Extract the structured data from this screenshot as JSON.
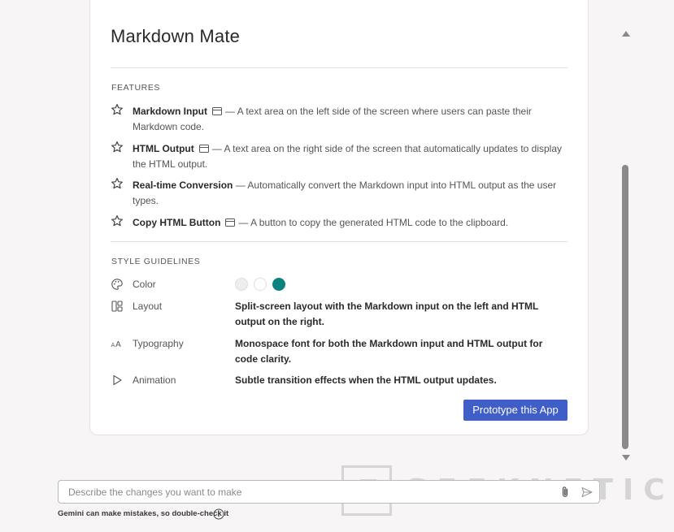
{
  "app": {
    "title": "Markdown Mate"
  },
  "features": {
    "heading": "FEATURES",
    "items": [
      {
        "name": "Markdown Input",
        "has_window_icon": true,
        "description": "— A text area on the left side of the screen where users can paste their Markdown code."
      },
      {
        "name": "HTML Output",
        "has_window_icon": true,
        "description": "— A text area on the right side of the screen that automatically updates to display the HTML output."
      },
      {
        "name": "Real-time Conversion",
        "has_window_icon": false,
        "description": "— Automatically convert the Markdown input into HTML output as the user types."
      },
      {
        "name": "Copy HTML Button",
        "has_window_icon": true,
        "description": "— A button to copy the generated HTML code to the clipboard."
      }
    ]
  },
  "style_guidelines": {
    "heading": "STYLE GUIDELINES",
    "color": {
      "label": "Color",
      "swatches": [
        "#efeeef",
        "#ffffff",
        "#0d8380"
      ]
    },
    "layout": {
      "label": "Layout",
      "value": "Split-screen layout with the Markdown input on the left and HTML output on the right."
    },
    "typography": {
      "label": "Typography",
      "value": "Monospace font for both the Markdown input and HTML output for code clarity."
    },
    "animation": {
      "label": "Animation",
      "value": "Subtle transition effects when the HTML output updates."
    }
  },
  "actions": {
    "prototype_label": "Prototype this App"
  },
  "prompt": {
    "placeholder": "Describe the changes you want to make",
    "value": ""
  },
  "disclaimer": "Gemini can make mistakes, so double-check it",
  "watermark": "GEEKNETIC",
  "colors": {
    "accent_button": "#3f5ec7",
    "teal_swatch": "#0d8380"
  }
}
